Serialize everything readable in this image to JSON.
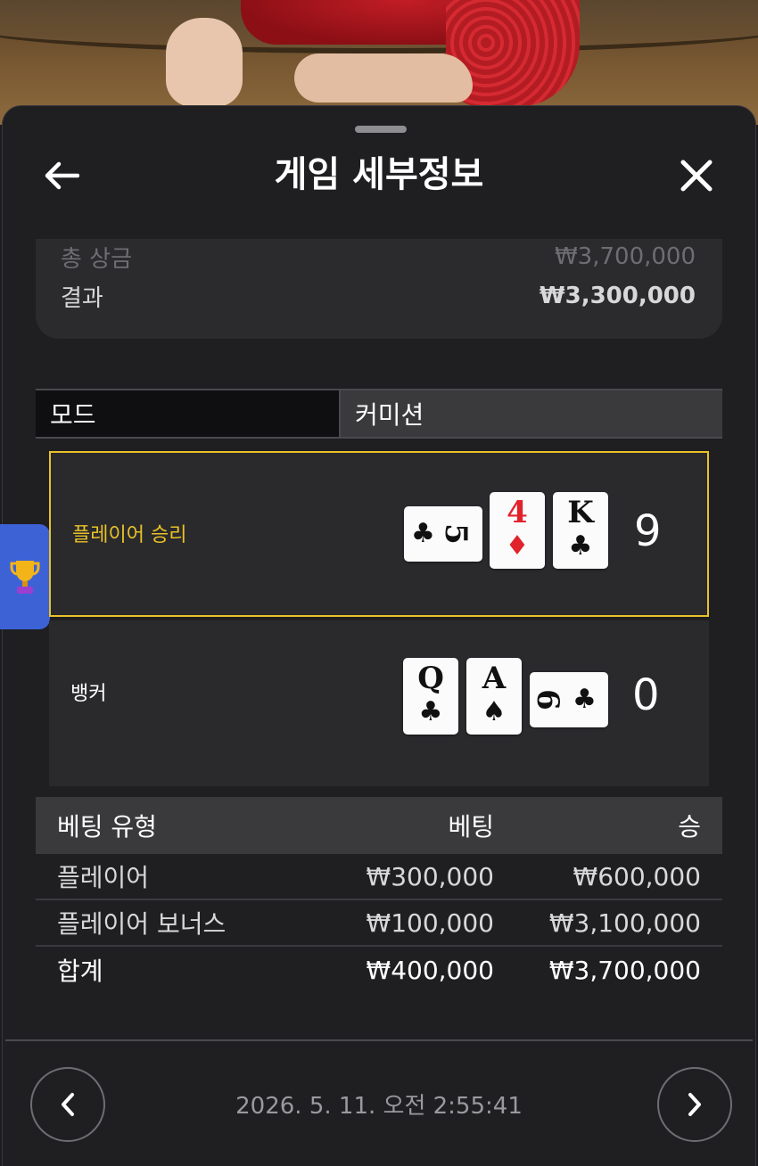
{
  "header": {
    "title": "게임 세부정보",
    "back_icon": "back-arrow-icon",
    "close_icon": "close-icon"
  },
  "summary": {
    "total_prize_label": "총 상금",
    "total_prize_value": "₩3,700,000",
    "result_label": "결과",
    "result_value": "₩3,300,000"
  },
  "mode": {
    "label": "모드",
    "value": "커미션"
  },
  "player": {
    "label": "플레이어 승리",
    "score": "9",
    "cards": [
      {
        "rank": "5",
        "suit": "♣",
        "orientation": "side"
      },
      {
        "rank": "4",
        "suit": "♦",
        "orientation": "up"
      },
      {
        "rank": "K",
        "suit": "♣",
        "orientation": "up"
      }
    ]
  },
  "banker": {
    "label": "뱅커",
    "score": "0",
    "cards": [
      {
        "rank": "Q",
        "suit": "♣",
        "orientation": "up"
      },
      {
        "rank": "A",
        "suit": "♠",
        "orientation": "up"
      },
      {
        "rank": "6",
        "suit": "♣",
        "orientation": "side"
      }
    ]
  },
  "bets": {
    "headers": [
      "베팅 유형",
      "베팅",
      "승"
    ],
    "rows": [
      {
        "type": "플레이어",
        "bet": "₩300,000",
        "win": "₩600,000"
      },
      {
        "type": "플레이어 보너스",
        "bet": "₩100,000",
        "win": "₩3,100,000"
      }
    ],
    "total": {
      "type": "합계",
      "bet": "₩400,000",
      "win": "₩3,700,000"
    }
  },
  "footer": {
    "timestamp": "2026. 5. 11. 오전 2:55:41",
    "prev_icon": "chevron-left-icon",
    "next_icon": "chevron-right-icon"
  },
  "side_tab": {
    "icon": "trophy-icon"
  },
  "colors": {
    "accent_gold": "#e8c228",
    "red_suit": "#e0232b",
    "tab_blue": "#3c62d6"
  }
}
